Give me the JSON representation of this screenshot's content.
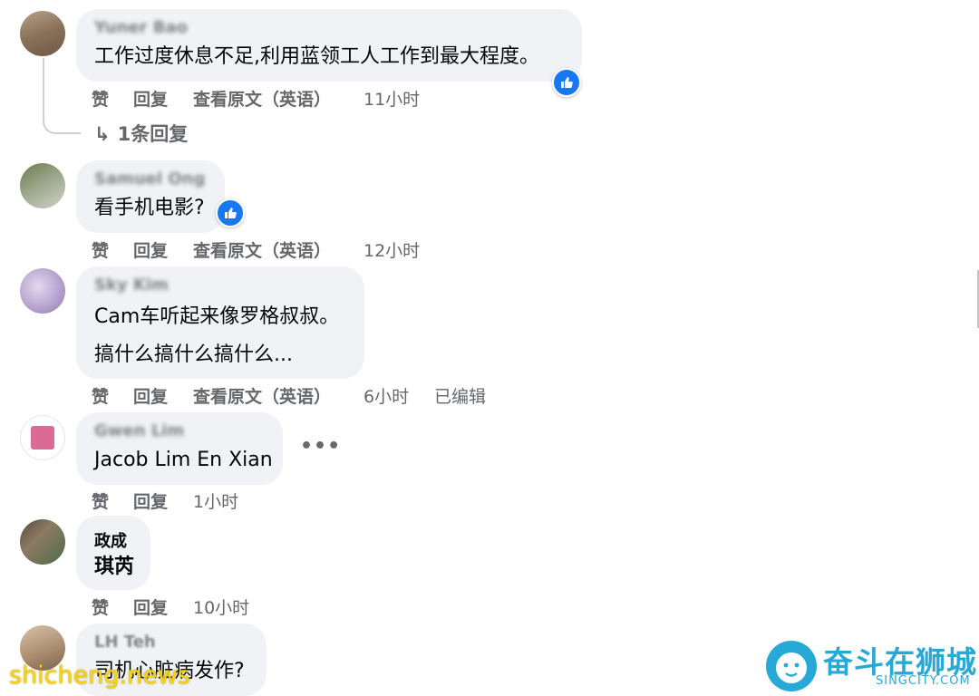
{
  "comments": [
    {
      "author": "Yuner Bao",
      "lines": [
        "工作过度休息不足,利用蓝领工人工作到最大程度。"
      ],
      "actions": {
        "like": "赞",
        "reply": "回复",
        "translate": "查看原文（英语）",
        "time": "11小时"
      },
      "replies_label": "1条回复"
    },
    {
      "author": "Samuel Ong",
      "lines": [
        "看手机电影?"
      ],
      "actions": {
        "like": "赞",
        "reply": "回复",
        "translate": "查看原文（英语）",
        "time": "12小时"
      }
    },
    {
      "author": "Sky Kim",
      "lines": [
        "Cam车听起来像罗格叔叔。",
        "搞什么搞什么搞什么..."
      ],
      "actions": {
        "like": "赞",
        "reply": "回复",
        "translate": "查看原文（英语）",
        "time": "6小时",
        "edited": "已编辑"
      }
    },
    {
      "author": "Gwen Lim",
      "lines": [
        "Jacob Lim En Xian"
      ],
      "actions": {
        "like": "赞",
        "reply": "回复",
        "time": "1小时"
      }
    },
    {
      "author": "政成",
      "lines": [
        "琪芮"
      ],
      "actions": {
        "like": "赞",
        "reply": "回复",
        "time": "10小时"
      }
    },
    {
      "author": "LH Teh",
      "lines": [
        "司机心脏病发作?"
      ]
    }
  ],
  "watermarks": {
    "left": "shicheng.news",
    "right_title": "奋斗在狮城",
    "right_sub": "SINGCITY.COM"
  },
  "colors": {
    "bubble": "#f0f2f5",
    "meta_text": "#65676b",
    "like_blue": "#1877f2",
    "brand_cyan": "#27a9d8",
    "watermark_yellow": "#f5d313"
  }
}
